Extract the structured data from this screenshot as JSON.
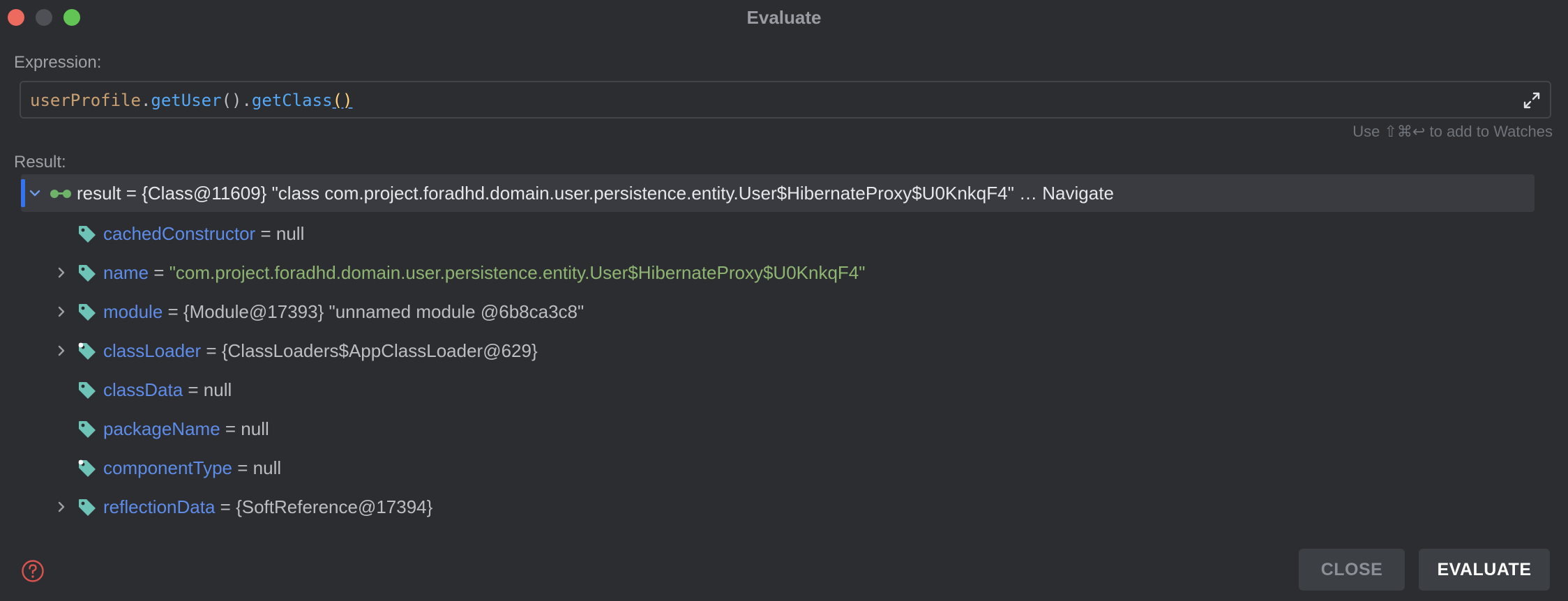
{
  "window": {
    "title": "Evaluate"
  },
  "expression": {
    "label": "Expression:",
    "tokens": {
      "var": "userProfile",
      "dot1": ".",
      "fn1": "getUser",
      "paren1": "()",
      "dot2": ".",
      "fn2": "getClass",
      "paren2": "()"
    },
    "hint": "Use ⇧⌘↩ to add to Watches"
  },
  "result": {
    "label": "Result:",
    "root": {
      "text": "result = {Class@11609} \"class com.project.foradhd.domain.user.persistence.entity.User$HibernateProxy$U0KnkqF4\" … Navigate"
    },
    "fields": [
      {
        "name": "cachedConstructor",
        "eq": " = ",
        "value": "null",
        "value_type": "plain",
        "expandable": false,
        "icon": "field-tag-icon"
      },
      {
        "name": "name",
        "eq": " = ",
        "value": "\"com.project.foradhd.domain.user.persistence.entity.User$HibernateProxy$U0KnkqF4\"",
        "value_type": "string",
        "expandable": true,
        "icon": "field-tag-icon"
      },
      {
        "name": "module",
        "eq": " = ",
        "value": "{Module@17393} \"unnamed module @6b8ca3c8\"",
        "value_type": "plain",
        "expandable": true,
        "icon": "field-tag-icon"
      },
      {
        "name": "classLoader",
        "eq": " = ",
        "value": "{ClassLoaders$AppClassLoader@629}",
        "value_type": "plain",
        "expandable": true,
        "icon": "static-field-tag-icon"
      },
      {
        "name": "classData",
        "eq": " = ",
        "value": "null",
        "value_type": "plain",
        "expandable": false,
        "icon": "field-tag-icon"
      },
      {
        "name": "packageName",
        "eq": " = ",
        "value": "null",
        "value_type": "plain",
        "expandable": false,
        "icon": "field-tag-icon"
      },
      {
        "name": "componentType",
        "eq": " = ",
        "value": "null",
        "value_type": "plain",
        "expandable": false,
        "icon": "static-field-tag-icon"
      },
      {
        "name": "reflectionData",
        "eq": " = ",
        "value": "{SoftReference@17394}",
        "value_type": "plain",
        "expandable": true,
        "icon": "field-tag-icon"
      }
    ]
  },
  "buttons": {
    "close": "CLOSE",
    "evaluate": "EVALUATE"
  },
  "colors": {
    "accent": "#3574f0",
    "field_name": "#5e8ce8",
    "string_value": "#8fb572",
    "tag_icon": "#6cc3b6"
  }
}
